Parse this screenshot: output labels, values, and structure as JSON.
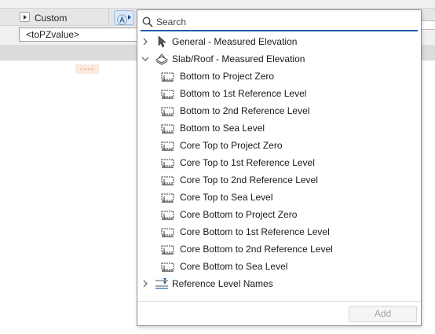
{
  "panel": {
    "row_label": "Custom",
    "value_text": "<toPZvalue>",
    "expression_button_glyph": "A",
    "indicator_text": "----"
  },
  "popup": {
    "search": {
      "placeholder": "Search",
      "value": "",
      "icon": "search-icon"
    },
    "groups": [
      {
        "label": "General - Measured Elevation",
        "expanded": false,
        "icon": "cursor-arrow-icon"
      },
      {
        "label": "Slab/Roof - Measured Elevation",
        "expanded": true,
        "icon": "slab-roof-icon",
        "items": [
          "Bottom to Project Zero",
          "Bottom to 1st Reference Level",
          "Bottom to 2nd Reference Level",
          "Bottom to Sea Level",
          "Core Top to Project Zero",
          "Core Top to 1st Reference Level",
          "Core Top to 2nd Reference Level",
          "Core Top to Sea Level",
          "Core Bottom to Project Zero",
          "Core Bottom to 1st Reference Level",
          "Core Bottom to 2nd Reference Level",
          "Core Bottom to Sea Level"
        ],
        "item_icon": "elevation-parameter-icon"
      },
      {
        "label": "Reference Level Names",
        "expanded": false,
        "icon": "reference-level-icon"
      }
    ],
    "add_button": {
      "label": "Add",
      "enabled": false
    }
  },
  "colors": {
    "accent": "#1f5fa8",
    "popup_border": "#8c8c8c",
    "disabled_text": "#a3a3a3"
  }
}
